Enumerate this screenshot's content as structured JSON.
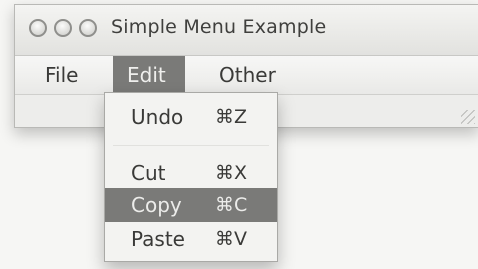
{
  "window": {
    "title": "Simple Menu Example"
  },
  "menubar": {
    "items": [
      "File",
      "Edit",
      "Other"
    ],
    "active": "Edit"
  },
  "edit_menu": {
    "items": [
      {
        "label": "Undo",
        "shortcut": "⌘Z"
      },
      {
        "label": "Cut",
        "shortcut": "⌘X"
      },
      {
        "label": "Copy",
        "shortcut": "⌘C",
        "highlighted": true
      },
      {
        "label": "Paste",
        "shortcut": "⌘V"
      }
    ]
  },
  "colors": {
    "highlight": "#7a7a78",
    "window_bg": "#eeeeec"
  }
}
